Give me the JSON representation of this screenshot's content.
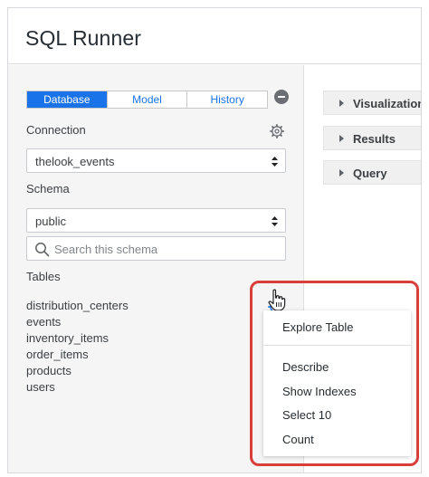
{
  "window": {
    "title": "SQL Runner"
  },
  "tabs": [
    {
      "label": "Database",
      "active": true
    },
    {
      "label": "Model",
      "active": false
    },
    {
      "label": "History",
      "active": false
    }
  ],
  "connection": {
    "label": "Connection",
    "value": "thelook_events"
  },
  "schema": {
    "label": "Schema",
    "value": "public"
  },
  "search": {
    "placeholder": "Search this schema",
    "value": ""
  },
  "tables": {
    "label": "Tables",
    "items": [
      "distribution_centers",
      "events",
      "inventory_items",
      "order_items",
      "products",
      "users"
    ]
  },
  "sections": [
    "Visualization",
    "Results",
    "Query"
  ],
  "context_menu": {
    "items": [
      "Explore Table",
      "Describe",
      "Show Indexes",
      "Select 10",
      "Count"
    ]
  },
  "colors": {
    "accent": "#1a73e8",
    "highlight": "#d93f3a",
    "panel_bg": "#f5f5f5"
  },
  "icons": [
    "minus-circle-icon",
    "gear-icon",
    "select-arrows-icon",
    "search-icon",
    "caret-right-icon",
    "hand-pointer-cursor"
  ]
}
